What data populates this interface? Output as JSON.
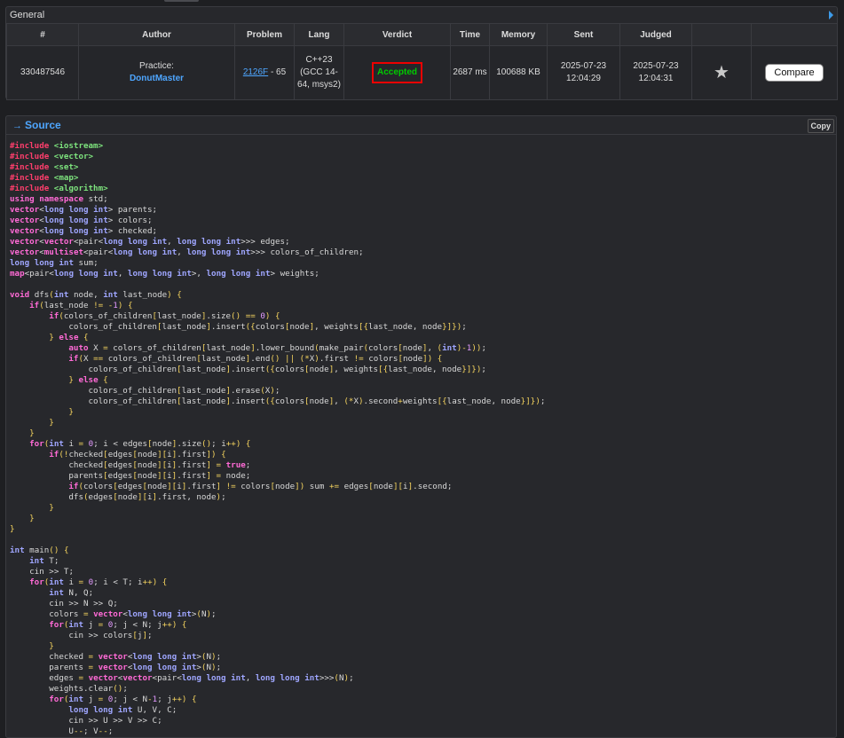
{
  "general": {
    "title": "General",
    "columns": [
      "#",
      "Author",
      "Problem",
      "Lang",
      "Verdict",
      "Time",
      "Memory",
      "Sent",
      "Judged",
      "",
      ""
    ],
    "row": {
      "id": "330487546",
      "author_prefix": "Practice:",
      "author_name": "DonutMaster",
      "problem_link": "2126F",
      "problem_score": " - 65",
      "lang": "C++23 (GCC 14-64, msys2)",
      "verdict": "Accepted",
      "time": "2687 ms",
      "memory": "100688 KB",
      "sent": "2025-07-23 12:04:29",
      "judged": "2025-07-23 12:04:31",
      "compare_label": "Compare"
    }
  },
  "source": {
    "title": "Source",
    "copy_label": "Copy",
    "code_lines": [
      "#include <iostream>",
      "#include <vector>",
      "#include <set>",
      "#include <map>",
      "#include <algorithm>",
      "using namespace std;",
      "vector<long long int> parents;",
      "vector<long long int> colors;",
      "vector<long long int> checked;",
      "vector<vector<pair<long long int, long long int>>> edges;",
      "vector<multiset<pair<long long int, long long int>>> colors_of_children;",
      "long long int sum;",
      "map<pair<long long int, long long int>, long long int> weights;",
      "",
      "void dfs(int node, int last_node) {",
      "    if(last_node != -1) {",
      "        if(colors_of_children[last_node].size() == 0) {",
      "            colors_of_children[last_node].insert({colors[node], weights[{last_node, node}]});",
      "        } else {",
      "            auto X = colors_of_children[last_node].lower_bound(make_pair(colors[node], (int)-1));",
      "            if(X == colors_of_children[last_node].end() || (*X).first != colors[node]) {",
      "                colors_of_children[last_node].insert({colors[node], weights[{last_node, node}]});",
      "            } else {",
      "                colors_of_children[last_node].erase(X);",
      "                colors_of_children[last_node].insert({colors[node], (*X).second+weights[{last_node, node}]});",
      "            }",
      "        }",
      "    }",
      "    for(int i = 0; i < edges[node].size(); i++) {",
      "        if(!checked[edges[node][i].first]) {",
      "            checked[edges[node][i].first] = true;",
      "            parents[edges[node][i].first] = node;",
      "            if(colors[edges[node][i].first] != colors[node]) sum += edges[node][i].second;",
      "            dfs(edges[node][i].first, node);",
      "        }",
      "    }",
      "}",
      "",
      "int main() {",
      "    int T;",
      "    cin >> T;",
      "    for(int i = 0; i < T; i++) {",
      "        int N, Q;",
      "        cin >> N >> Q;",
      "        colors = vector<long long int>(N);",
      "        for(int j = 0; j < N; j++) {",
      "            cin >> colors[j];",
      "        }",
      "        checked = vector<long long int>(N);",
      "        parents = vector<long long int>(N);",
      "        edges = vector<vector<pair<long long int, long long int>>>(N);",
      "        weights.clear();",
      "        for(int j = 0; j < N-1; j++) {",
      "            long long int U, V, C;",
      "            cin >> U >> V >> C;",
      "            U--; V--;"
    ]
  },
  "colors": {
    "accent_link": "#4ea6ff",
    "verdict_ok": "#00cc00",
    "verdict_border": "#ee0000",
    "background": "#1e1f22"
  }
}
